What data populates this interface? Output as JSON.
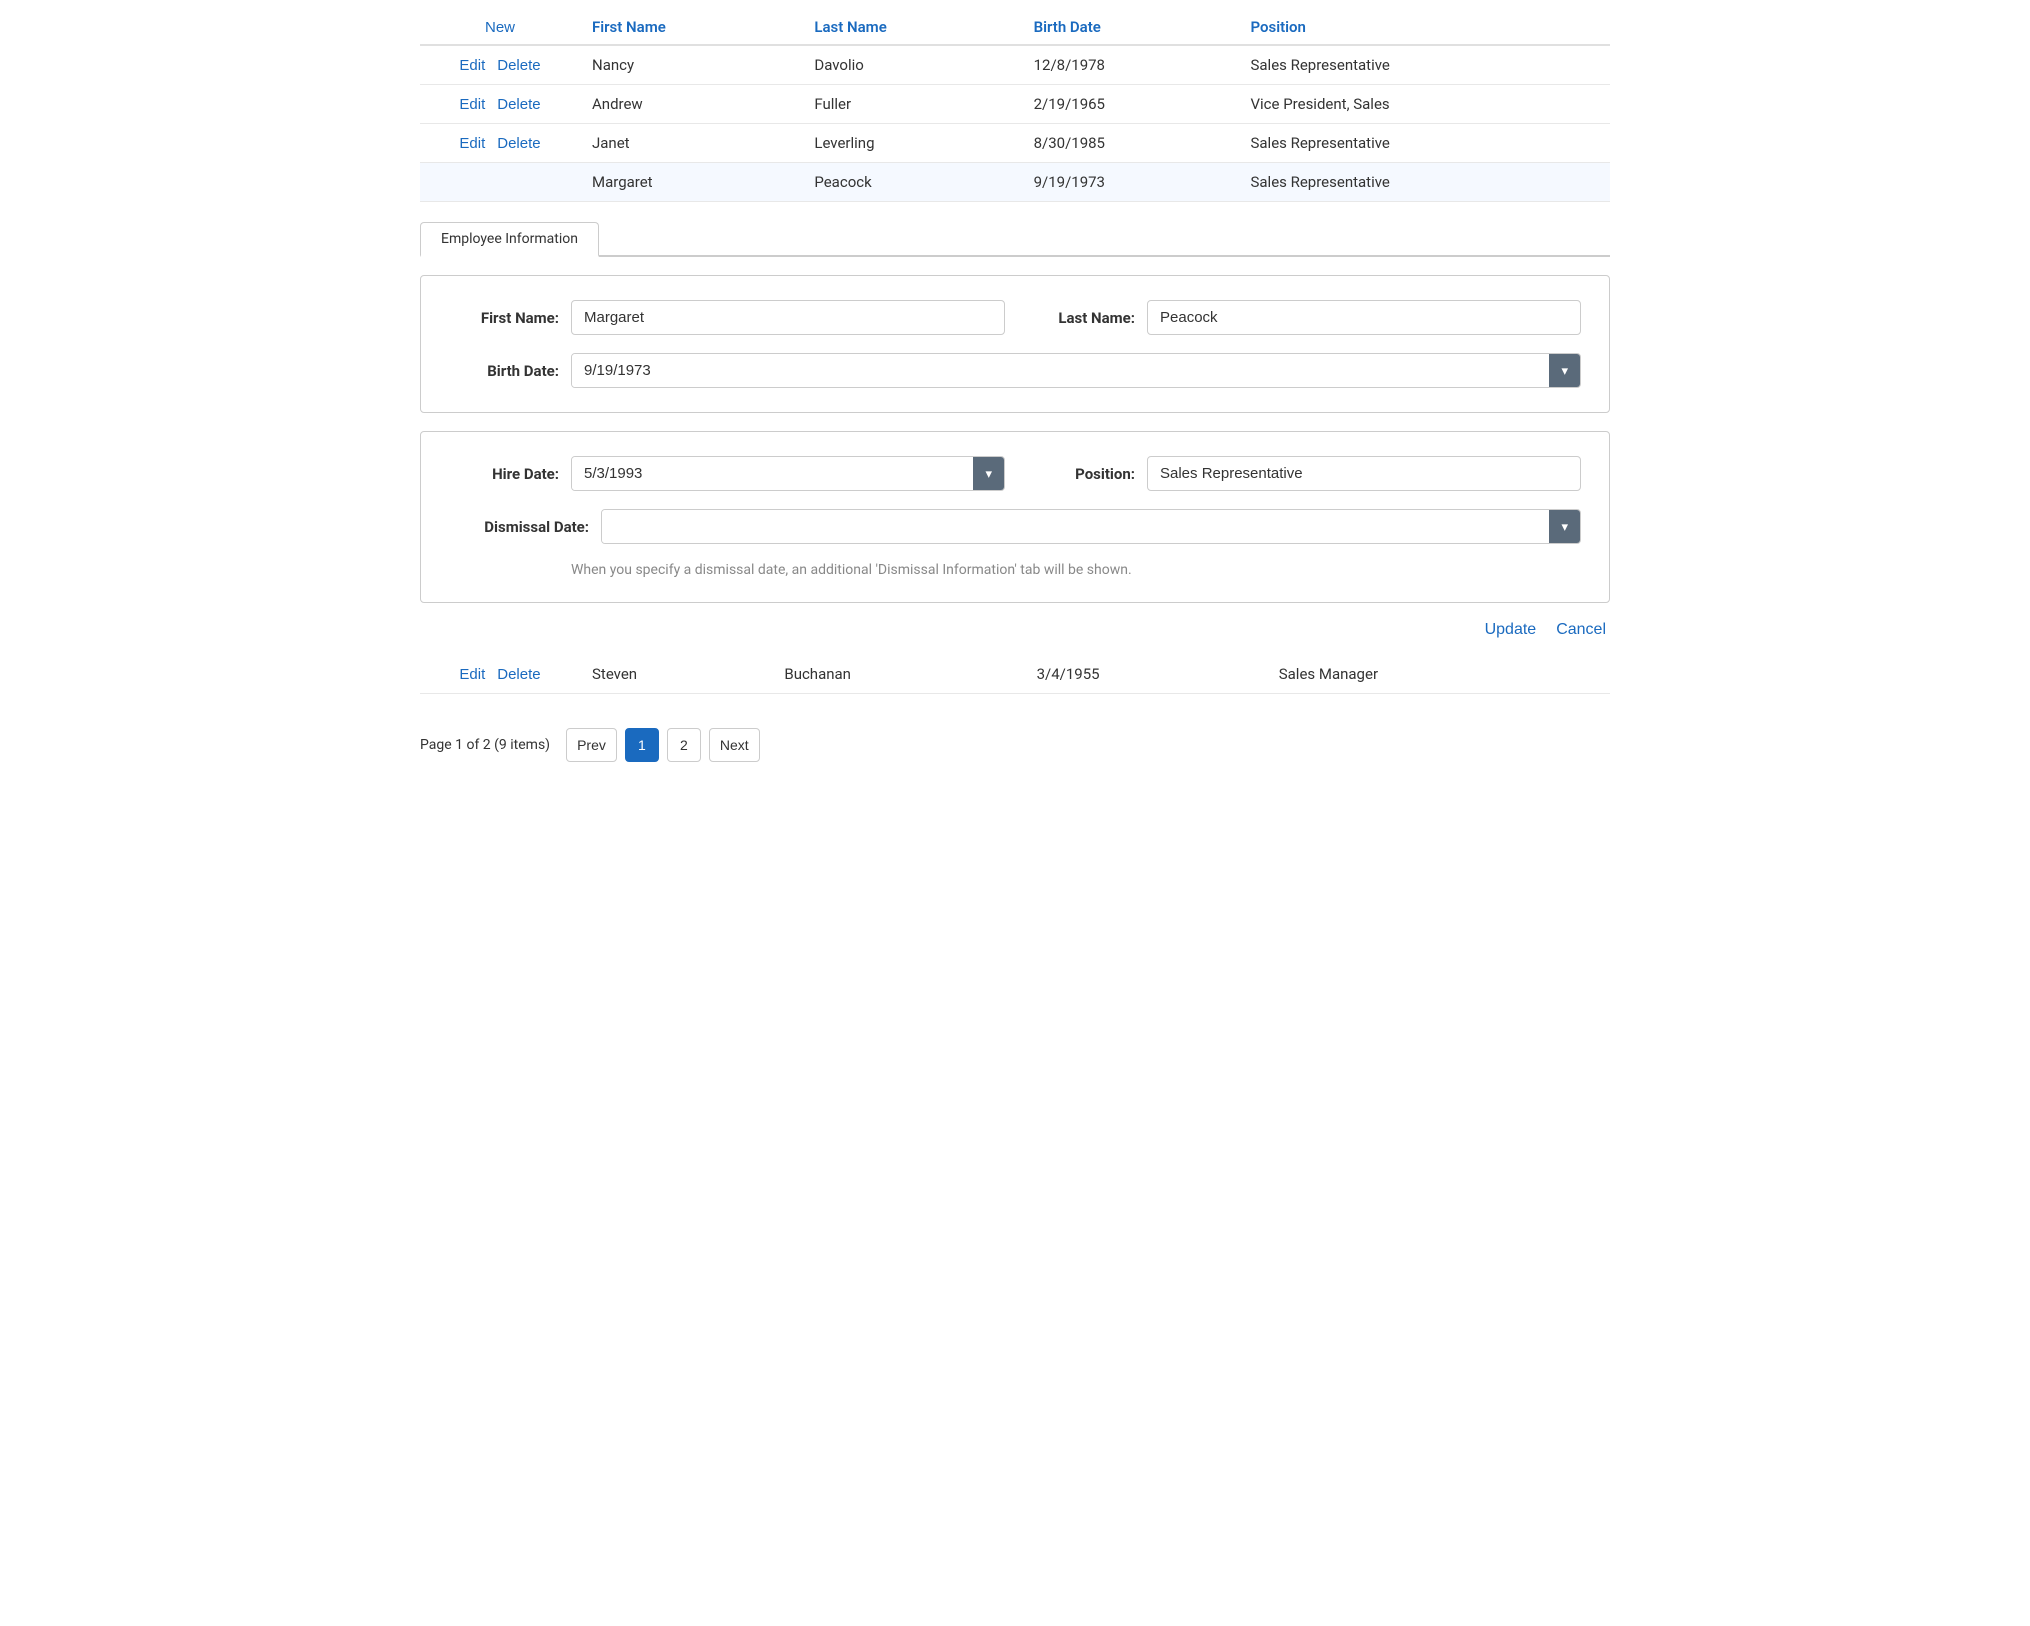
{
  "table": {
    "columns": [
      {
        "key": "actions",
        "label": "New"
      },
      {
        "key": "firstName",
        "label": "First Name"
      },
      {
        "key": "lastName",
        "label": "Last Name"
      },
      {
        "key": "birthDate",
        "label": "Birth Date"
      },
      {
        "key": "position",
        "label": "Position"
      }
    ],
    "rows": [
      {
        "firstName": "Nancy",
        "lastName": "Davolio",
        "birthDate": "12/8/1978",
        "position": "Sales Representative",
        "hasActions": true
      },
      {
        "firstName": "Andrew",
        "lastName": "Fuller",
        "birthDate": "2/19/1965",
        "position": "Vice President, Sales",
        "hasActions": true
      },
      {
        "firstName": "Janet",
        "lastName": "Leverling",
        "birthDate": "8/30/1985",
        "position": "Sales Representative",
        "hasActions": true
      },
      {
        "firstName": "Margaret",
        "lastName": "Peacock",
        "birthDate": "9/19/1973",
        "position": "Sales Representative",
        "hasActions": false,
        "selected": true
      },
      {
        "firstName": "Steven",
        "lastName": "Buchanan",
        "birthDate": "3/4/1955",
        "position": "Sales Manager",
        "hasActions": true
      }
    ],
    "editLabel": "Edit",
    "deleteLabel": "Delete",
    "newLabel": "New"
  },
  "tabs": [
    {
      "label": "Employee Information",
      "active": true
    }
  ],
  "form": {
    "personalCard": {
      "firstNameLabel": "First Name:",
      "firstNameValue": "Margaret",
      "lastNameLabel": "Last Name:",
      "lastNameValue": "Peacock",
      "birthDateLabel": "Birth Date:",
      "birthDateValue": "9/19/1973"
    },
    "employmentCard": {
      "hireDateLabel": "Hire Date:",
      "hireDateValue": "5/3/1993",
      "positionLabel": "Position:",
      "positionValue": "Sales Representative",
      "dismissalDateLabel": "Dismissal Date:",
      "dismissalDateValue": "",
      "helpText": "When you specify a dismissal date, an additional 'Dismissal Information' tab will be shown."
    }
  },
  "actions": {
    "updateLabel": "Update",
    "cancelLabel": "Cancel"
  },
  "pagination": {
    "info": "Page 1 of 2 (9 items)",
    "prevLabel": "Prev",
    "nextLabel": "Next",
    "currentPage": 1,
    "totalPages": 2,
    "pages": [
      "1",
      "2"
    ]
  },
  "icons": {
    "chevronDown": "▾"
  }
}
